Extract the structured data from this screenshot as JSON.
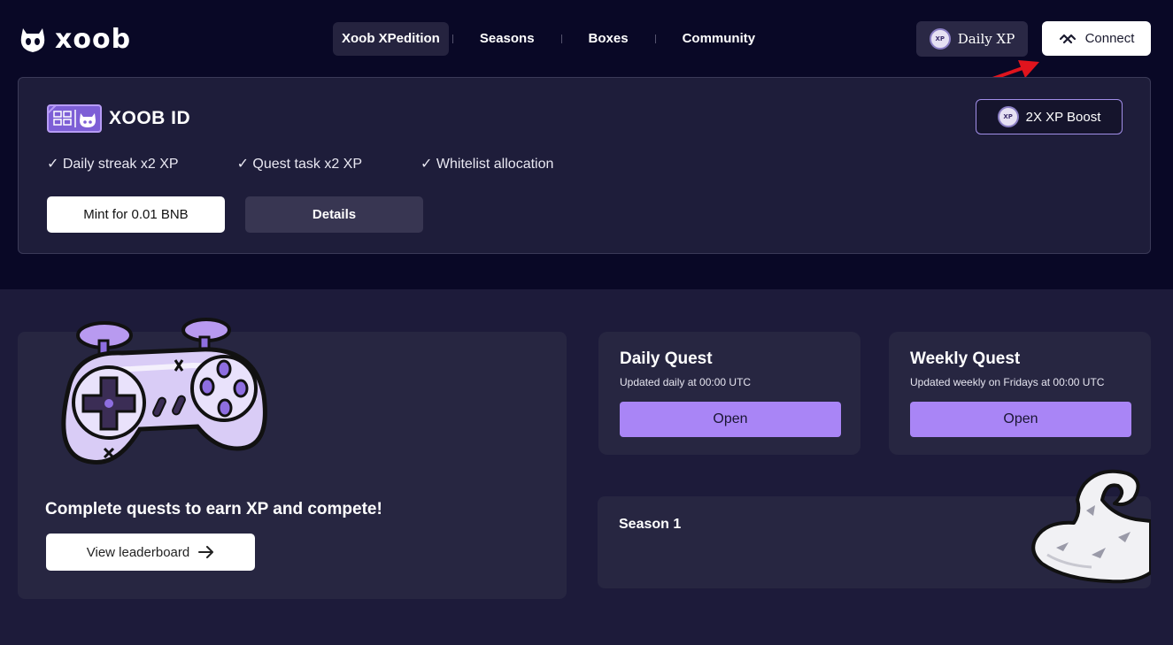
{
  "brand": {
    "name": "xoob"
  },
  "nav": {
    "items": [
      {
        "label": "Xoob XPedition",
        "active": true
      },
      {
        "label": "Seasons",
        "active": false
      },
      {
        "label": "Boxes",
        "active": false
      },
      {
        "label": "Community",
        "active": false
      }
    ]
  },
  "header": {
    "daily_xp_label": "Daily XP",
    "connect_label": "Connect",
    "xp_coin_text": "XP"
  },
  "id_card": {
    "title": "XOOB ID",
    "boost_label": "2X XP Boost",
    "benefits": [
      "✓ Daily streak x2 XP",
      "✓ Quest task x2 XP",
      "✓ Whitelist allocation"
    ],
    "mint_label": "Mint for 0.01 BNB",
    "details_label": "Details"
  },
  "main_quest": {
    "heading": "Complete quests to earn XP and compete!",
    "leaderboard_label": "View leaderboard"
  },
  "daily_quest": {
    "title": "Daily Quest",
    "subtitle": "Updated daily at 00:00 UTC",
    "button": "Open"
  },
  "weekly_quest": {
    "title": "Weekly Quest",
    "subtitle": "Updated weekly on Fridays at 00:00 UTC",
    "button": "Open"
  },
  "season": {
    "title": "Season 1"
  },
  "colors": {
    "background": "#1d1b3a",
    "top_background": "#090826",
    "card": "#272641",
    "accent_purple": "#a985f6",
    "annotation_arrow": "#e0141d"
  }
}
